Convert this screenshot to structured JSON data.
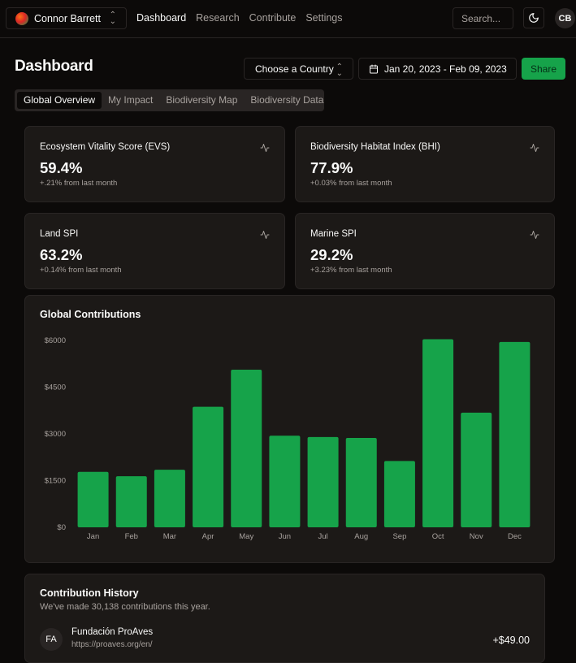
{
  "header": {
    "team_name": "Connor Barrett",
    "nav": [
      "Dashboard",
      "Research",
      "Contribute",
      "Settings"
    ],
    "search_placeholder": "Search...",
    "avatar_initials": "CB"
  },
  "page": {
    "title": "Dashboard",
    "country_select": "Choose a Country",
    "date_range": "Jan 20, 2023 - Feb 09, 2023",
    "share_label": "Share"
  },
  "tabs": [
    "Global Overview",
    "My Impact",
    "Biodiversity Map",
    "Biodiversity Data"
  ],
  "kpis": [
    {
      "label": "Ecosystem Vitality Score (EVS)",
      "value": "59.4%",
      "sub": "+.21% from last month"
    },
    {
      "label": "Biodiversity Habitat Index (BHI)",
      "value": "77.9%",
      "sub": "+0.03% from last month"
    },
    {
      "label": "Land SPI",
      "value": "63.2%",
      "sub": "+0.14% from last month"
    },
    {
      "label": "Marine SPI",
      "value": "29.2%",
      "sub": "+3.23% from last month"
    }
  ],
  "chart_data": {
    "type": "bar",
    "title": "Global Contributions",
    "categories": [
      "Jan",
      "Feb",
      "Mar",
      "Apr",
      "May",
      "Jun",
      "Jul",
      "Aug",
      "Sep",
      "Oct",
      "Nov",
      "Dec"
    ],
    "values": [
      1780,
      1640,
      1850,
      3870,
      5060,
      2940,
      2900,
      2870,
      2130,
      6040,
      3680,
      5950
    ],
    "yticks": [
      "$0",
      "$1500",
      "$3000",
      "$4500",
      "$6000"
    ],
    "ylim": [
      0,
      6000
    ],
    "color": "#16a34a"
  },
  "history": {
    "title": "Contribution History",
    "subtitle": "We've made 30,138 contributions this year.",
    "rows": [
      {
        "initials": "FA",
        "name": "Fundación ProAves",
        "url": "https://proaves.org/en/",
        "amount": "+$49.00"
      }
    ]
  },
  "colors": {
    "accent": "#16a34a",
    "background": "#0c0a09",
    "card": "#1c1917",
    "border": "#292524",
    "muted": "#a8a29e"
  }
}
